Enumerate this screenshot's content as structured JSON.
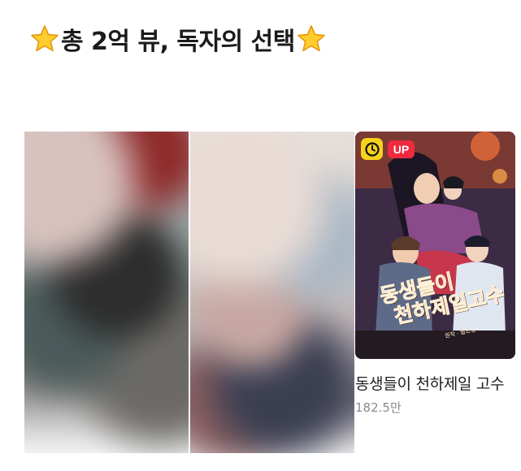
{
  "section": {
    "title": "총 2억 뷰, 독자의 선택",
    "icon_left": "star-icon",
    "icon_right": "star-icon"
  },
  "cards": [
    {
      "state": "blurred"
    },
    {
      "state": "blurred"
    },
    {
      "title": "동생들이 천하제일 고수",
      "views": "182.5만",
      "badges": {
        "clock": "clock-icon",
        "up": "UP"
      },
      "cover_title_line1": "동생들이",
      "cover_title_line2": "천하제일고수",
      "cover_subtitle": "원작 · 웹소설"
    }
  ],
  "colors": {
    "up_badge": "#f0293e",
    "clock_badge": "#f5d21c",
    "title_text": "#1e1e1e",
    "view_text": "#8a8a8a"
  }
}
